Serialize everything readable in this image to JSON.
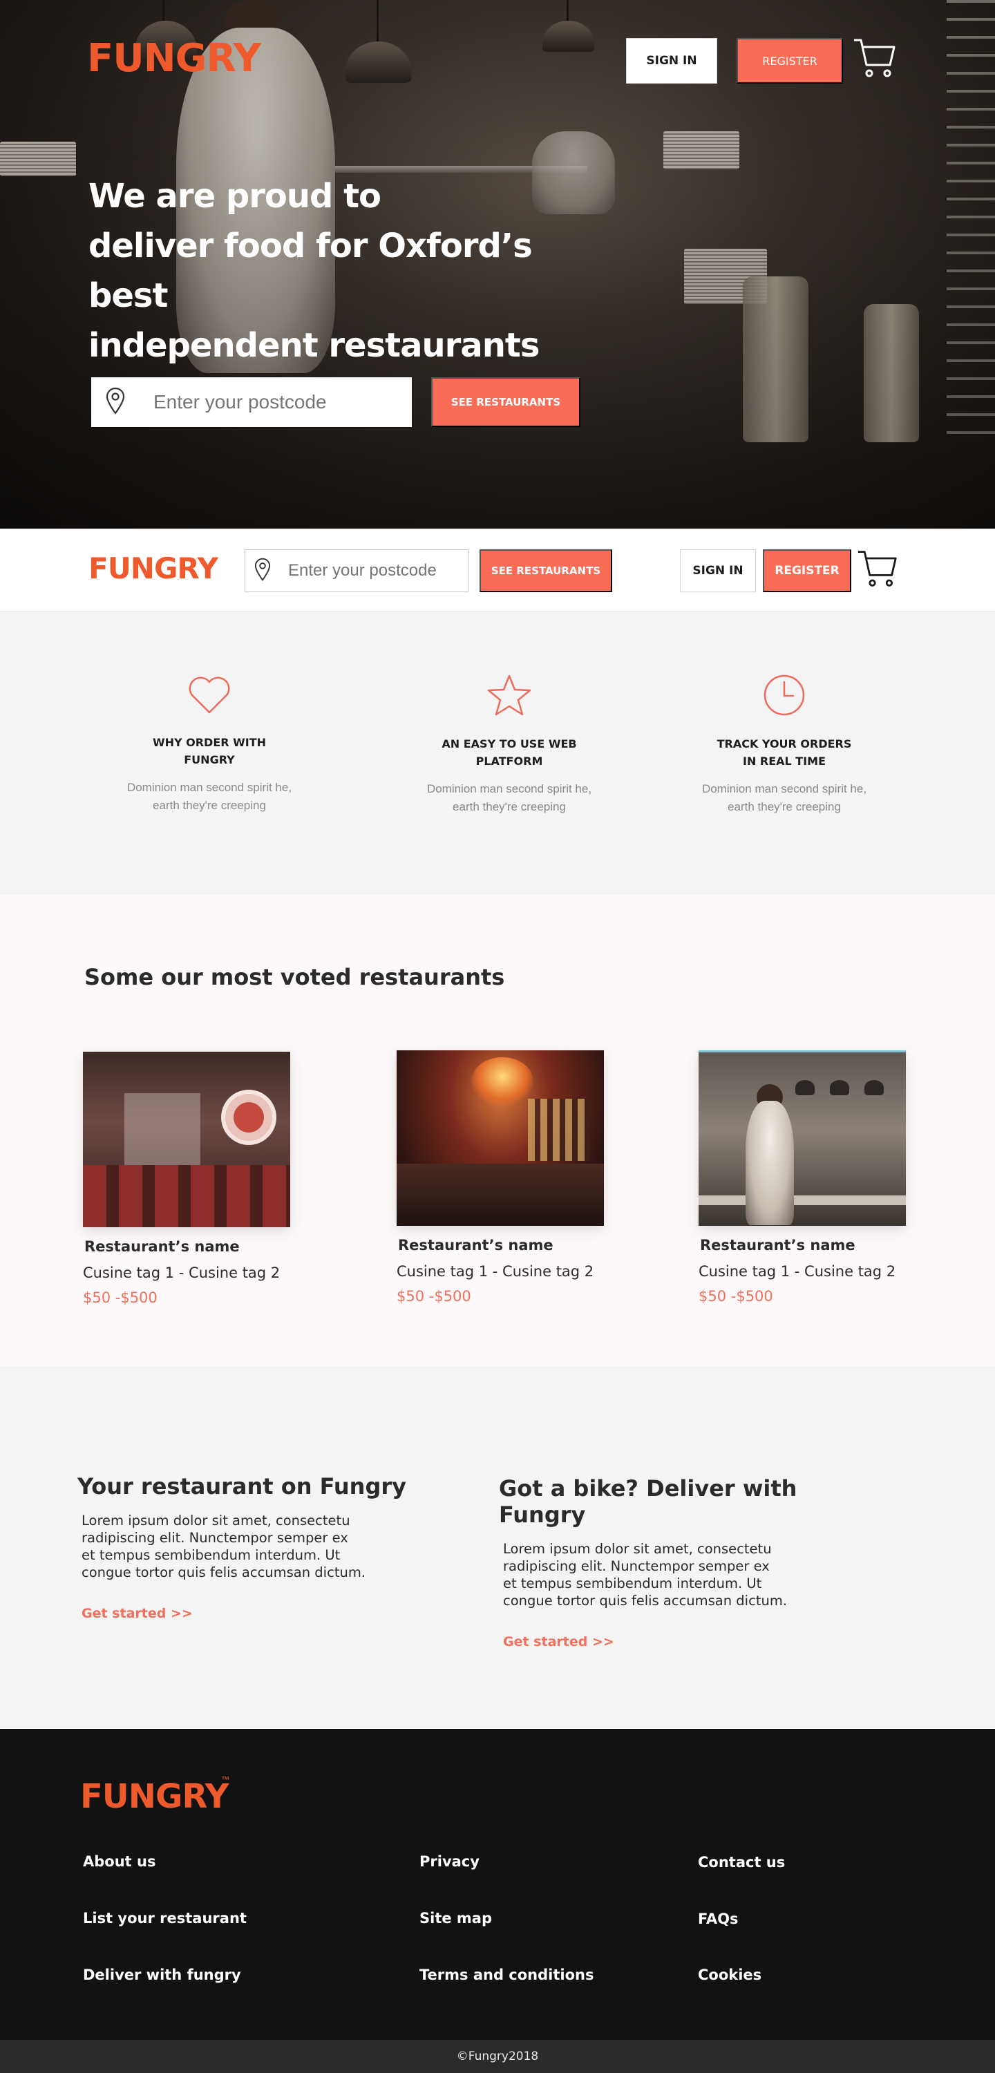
{
  "brand": {
    "name": "FUNGRY",
    "color": "#ee5a2c",
    "accent": "#fa6c55",
    "trademark": "™"
  },
  "header": {
    "sign_in_label": "SIGN IN",
    "register_label": "REGISTER",
    "cart_icon": "cart-icon"
  },
  "hero": {
    "headline_lines": [
      "We are proud to",
      "deliver food for Oxford’s best",
      "independent restaurants"
    ],
    "postcode_placeholder": "Enter your postcode",
    "see_restaurants_label": "SEE RESTAURANTS",
    "pin_icon": "location-pin-icon"
  },
  "sticky_bar": {
    "postcode_placeholder": "Enter your postcode",
    "see_restaurants_label": "SEE RESTAURANTS",
    "sign_in_label": "SIGN IN",
    "register_label": "REGISTER"
  },
  "features": [
    {
      "icon": "heart-icon",
      "title_lines": [
        "WHY ORDER WITH",
        "FUNGRY"
      ],
      "desc_lines": [
        "Dominion man second spirit he,",
        "earth they're creeping"
      ]
    },
    {
      "icon": "star-icon",
      "title_lines": [
        "AN EASY TO  USE WEB",
        "PLATFORM"
      ],
      "desc_lines": [
        "Dominion man second spirit he,",
        "earth they're creeping"
      ]
    },
    {
      "icon": "clock-icon",
      "title_lines": [
        "TRACK YOUR ORDERS",
        "IN REAL TIME"
      ],
      "desc_lines": [
        "Dominion man second spirit he,",
        "earth they're creeping"
      ]
    }
  ],
  "restaurants": {
    "title": "Some our most voted restaurants",
    "cards": [
      {
        "name": "Restaurant’s  name",
        "tags": "Cusine tag 1 - Cusine tag 2",
        "price": "$50 -$500"
      },
      {
        "name": "Restaurant’s  name",
        "tags": "Cusine tag 1 - Cusine tag 2",
        "price": "$50 -$500"
      },
      {
        "name": "Restaurant’s  name",
        "tags": "Cusine tag 1 - Cusine tag 2",
        "price": "$50 -$500"
      }
    ]
  },
  "partner": [
    {
      "title": "Your restaurant on Fungry",
      "body_lines": [
        "Lorem ipsum dolor sit amet, consectetu",
        "radipiscing elit. Nunctempor semper ex",
        "et tempus sembibendum interdum. Ut",
        "congue tortor quis felis accumsan dictum."
      ],
      "link": "Get started >>"
    },
    {
      "title": "Got a bike? Deliver with Fungry",
      "body_lines": [
        "Lorem ipsum dolor sit amet, consectetu",
        "radipiscing elit. Nunctempor semper ex",
        "et tempus sembibendum interdum. Ut",
        "congue tortor quis felis accumsan dictum."
      ],
      "link": "Get started >>"
    }
  ],
  "footer": {
    "links": [
      [
        "About us",
        "List your restaurant",
        "Deliver with fungry"
      ],
      [
        "Privacy",
        "Site map",
        "Terms and conditions"
      ],
      [
        "Contact us",
        "FAQs",
        "Cookies"
      ]
    ],
    "copyright": "©Fungry2018"
  }
}
